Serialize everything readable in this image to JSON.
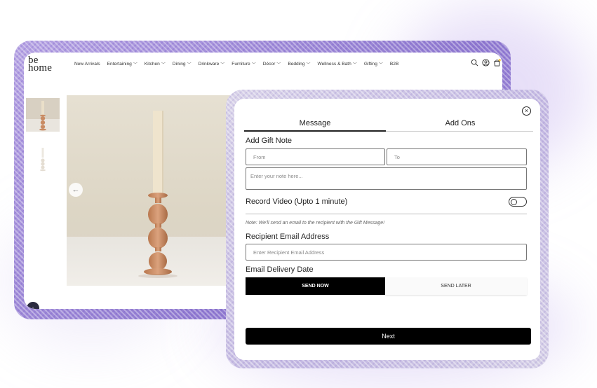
{
  "store": {
    "logo": {
      "line1": "be",
      "line2": "home"
    },
    "nav": [
      {
        "label": "New Arrivals",
        "has_dropdown": false
      },
      {
        "label": "Entertaining",
        "has_dropdown": true
      },
      {
        "label": "Kitchen",
        "has_dropdown": true
      },
      {
        "label": "Dining",
        "has_dropdown": true
      },
      {
        "label": "Drinkware",
        "has_dropdown": true
      },
      {
        "label": "Furniture",
        "has_dropdown": true
      },
      {
        "label": "Décor",
        "has_dropdown": true
      },
      {
        "label": "Bedding",
        "has_dropdown": true
      },
      {
        "label": "Wellness & Bath",
        "has_dropdown": true
      },
      {
        "label": "Gifting",
        "has_dropdown": true
      },
      {
        "label": "B2B",
        "has_dropdown": false
      }
    ],
    "icons": [
      "search-icon",
      "account-icon",
      "cart-icon"
    ],
    "accent_badge": "#f5c542"
  },
  "modal": {
    "tabs": [
      {
        "label": "Message",
        "active": true
      },
      {
        "label": "Add Ons",
        "active": false
      }
    ],
    "gift_note_heading": "Add Gift Note",
    "from_placeholder": "From",
    "to_placeholder": "To",
    "note_placeholder": "Enter your note here...",
    "record_video_label": "Record Video (Upto 1 minute)",
    "record_video_enabled": false,
    "note_text": "Note: We'll send an email to the recipient with the Gift Message!",
    "recipient_email_label": "Recipient Email Address",
    "recipient_email_placeholder": "Enter Recipient Email Address",
    "delivery_date_label": "Email Delivery Date",
    "send_now_label": "SEND NOW",
    "send_later_label": "SEND LATER",
    "next_label": "Next"
  },
  "colors": {
    "frame_purple": "#9b86d6",
    "primary_black": "#000000",
    "candle_glass": "#c98b63"
  }
}
